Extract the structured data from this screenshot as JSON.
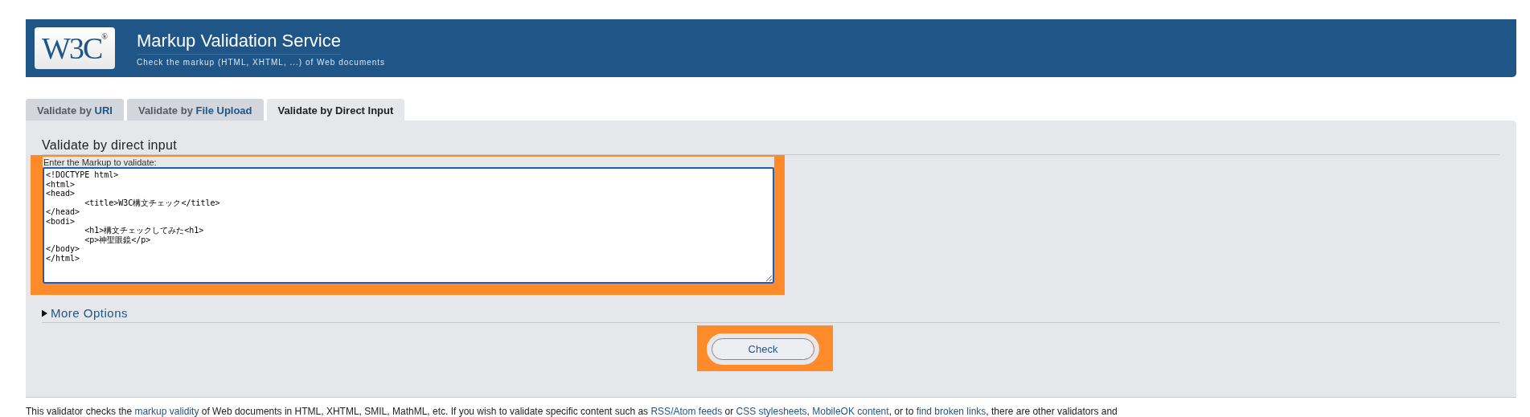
{
  "header": {
    "logo": {
      "text": "W3C",
      "mark": "®"
    },
    "title": "Markup Validation Service",
    "subtitle": "Check the markup (HTML, XHTML, ...) of Web documents"
  },
  "tabs": [
    {
      "prefix": "Validate by",
      "label": "URI",
      "selected": false
    },
    {
      "prefix": "Validate by",
      "label": "File Upload",
      "selected": false
    },
    {
      "prefix": "Validate by",
      "label": "Direct Input",
      "selected": true
    }
  ],
  "panel": {
    "heading": "Validate by direct input",
    "input": {
      "label": "Enter the Markup to validate:",
      "highlighted": true,
      "value": "<!DOCTYPE html>\n<html>\n<head>\n\t<title>W3C構文チェック</title>\n</head>\n<bodi>\n\t<h1>構文チェックしてみた<h1>\n\t<p>神聖眼鏡</p>\n</body>\n</html>\n"
    },
    "more_options": {
      "label": "More Options",
      "expanded": false
    },
    "check_button": {
      "label": "Check",
      "highlighted": true
    }
  },
  "intro": [
    {
      "text": "This validator checks the ",
      "link": false
    },
    {
      "text": "markup validity",
      "link": true
    },
    {
      "text": " of Web documents in HTML, XHTML, SMIL, MathML, etc. If you wish to validate specific content such as ",
      "link": false
    },
    {
      "text": "RSS/Atom feeds",
      "link": true
    },
    {
      "text": " or ",
      "link": false
    },
    {
      "text": "CSS stylesheets",
      "link": true
    },
    {
      "text": ", ",
      "link": false
    },
    {
      "text": "MobileOK content",
      "link": true
    },
    {
      "text": ", or to ",
      "link": false
    },
    {
      "text": "find broken links",
      "link": true
    },
    {
      "text": ", there are other validators and",
      "link": false
    }
  ]
}
